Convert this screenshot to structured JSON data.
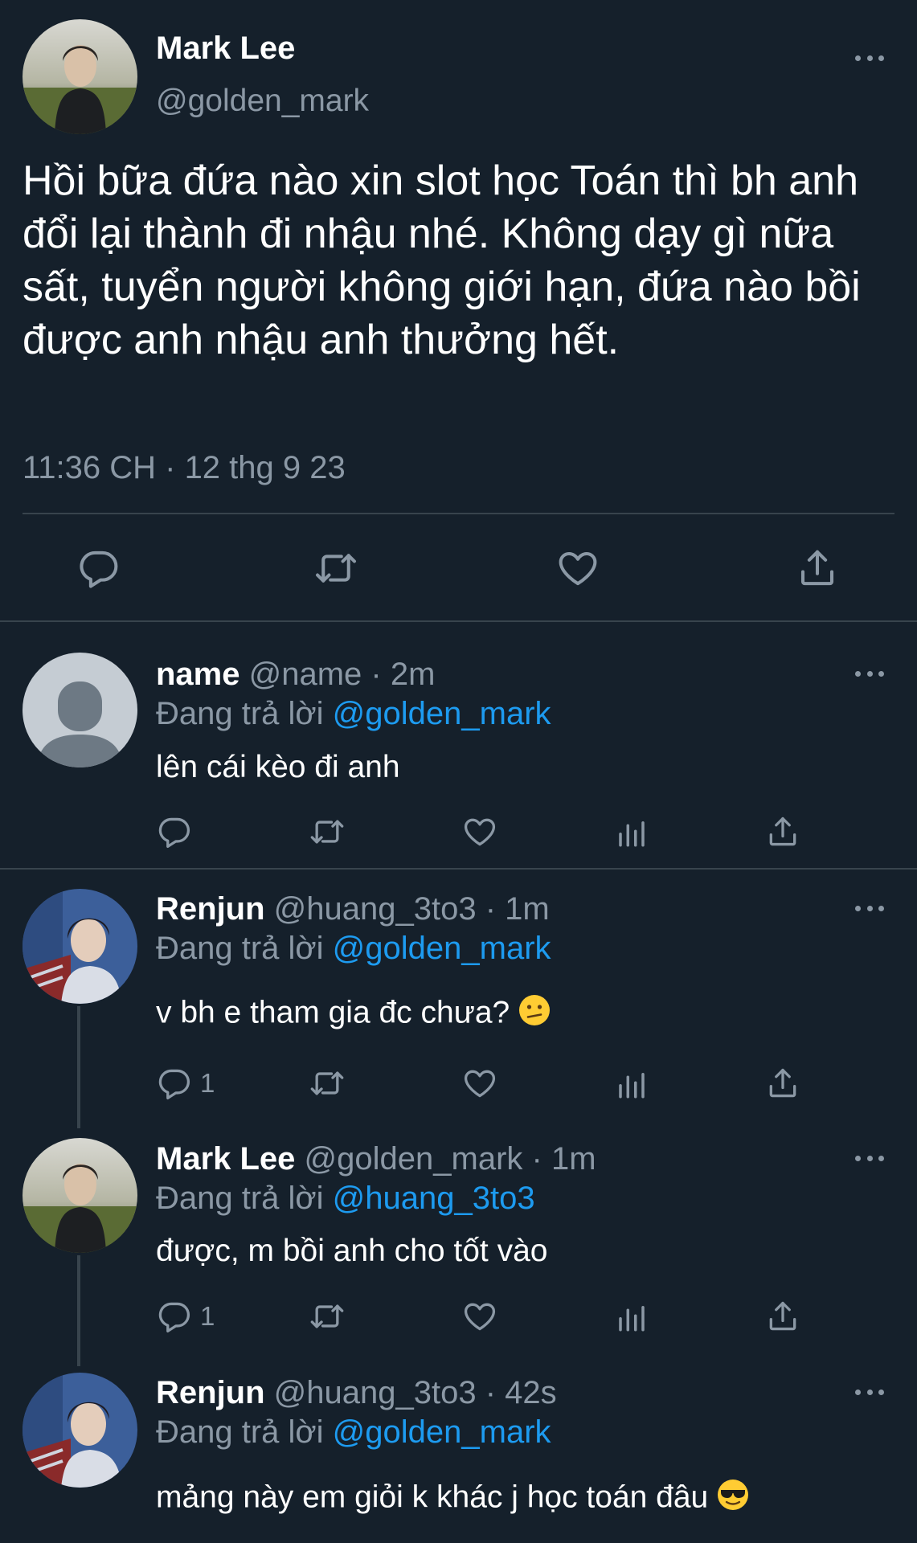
{
  "main_tweet": {
    "author_name": "Mark Lee",
    "author_handle": "@golden_mark",
    "text": "Hồi bữa đứa nào xin slot học Toán thì bh anh đổi lại thành đi nhậu nhé. Không dạy gì nữa sất, tuyển người không giới hạn, đứa nào bồi được anh nhậu anh thưởng hết.",
    "timestamp": "11:36 CH · 12 thg 9 23"
  },
  "replies": [
    {
      "name": "name",
      "meta": "@name · 2m",
      "replying_prefix": "Đang trả lời",
      "replying_to": "@golden_mark",
      "text": "lên cái kèo đi anh",
      "reply_count": ""
    },
    {
      "name": "Renjun",
      "meta": "@huang_3to3 · 1m",
      "replying_prefix": "Đang trả lời",
      "replying_to": "@golden_mark",
      "text": "v bh e tham gia đc chưa?",
      "reply_count": "1"
    },
    {
      "name": "Mark Lee",
      "meta": "@golden_mark · 1m",
      "replying_prefix": "Đang trả lời",
      "replying_to": "@huang_3to3",
      "text": "được, m bồi anh cho tốt vào",
      "reply_count": "1"
    },
    {
      "name": "Renjun",
      "meta": "@huang_3to3 · 42s",
      "replying_prefix": "Đang trả lời",
      "replying_to": "@golden_mark",
      "text": "mảng này em giỏi k khác j học toán đâu",
      "reply_count": ""
    }
  ],
  "icons": {
    "reply": "reply-icon",
    "retweet": "retweet-icon",
    "like": "like-icon",
    "views": "views-icon",
    "share": "share-icon",
    "more": "more-icon",
    "emoji_confused": "confused-face-emoji",
    "emoji_sunglasses": "sunglasses-face-emoji"
  },
  "colors": {
    "background": "#15202b",
    "text_primary": "#ffffff",
    "text_secondary": "#8b98a5",
    "link": "#1d9bf0",
    "divider": "#38444d"
  }
}
